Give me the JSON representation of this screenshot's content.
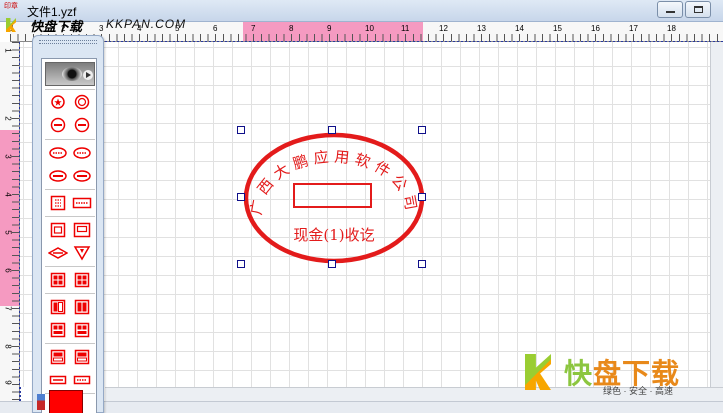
{
  "window": {
    "app_icon_text": "印章",
    "title": "文件1.yzf",
    "min_label": "minimize",
    "max_label": "maximize"
  },
  "watermark_top": {
    "brand": "快盘下载",
    "url": "KKPAN.COM"
  },
  "ruler_top": {
    "labels": [
      "1",
      "2",
      "3",
      "4",
      "5",
      "6",
      "7",
      "8",
      "9",
      "10",
      "11",
      "12",
      "13",
      "14",
      "15",
      "16",
      "17",
      "18"
    ],
    "highlight_color": "#f59ac1"
  },
  "ruler_left": {
    "labels": [
      "1",
      "2",
      "3",
      "4",
      "5",
      "6",
      "7",
      "8",
      "9"
    ]
  },
  "palette": {
    "tools": [
      "eye-tool",
      "star-circle-tool",
      "circle-bar-tool",
      "double-circle-tool",
      "double-circle-2-tool",
      "dotted-ellipse-tool",
      "dotted-ellipse-2-tool",
      "ellipse-bar-tool",
      "ellipse-bar-2-tool",
      "grid-square-tool",
      "grid-rect-tool",
      "double-square-tool",
      "double-rect-tool",
      "diamond-ellipse-tool",
      "triangle-tool",
      "four-box-tool",
      "four-box-2-tool",
      "split-box-tool",
      "split-box-2-tool",
      "box-grid-tool",
      "box-grid-2-tool",
      "box-line-tool",
      "box-line-2-tool",
      "wide-rect-tool",
      "wide-rect-2-tool"
    ],
    "fill_color": "#ff0000"
  },
  "seal": {
    "arc_text": "广西大鹏应用软件公司",
    "bottom_text": "现金(1)收讫",
    "color": "#e31b1b"
  },
  "watermark_bottom": {
    "brand_a": "快",
    "brand_b": "盘下载",
    "tagline": "绿色 · 安全 · 高速"
  }
}
